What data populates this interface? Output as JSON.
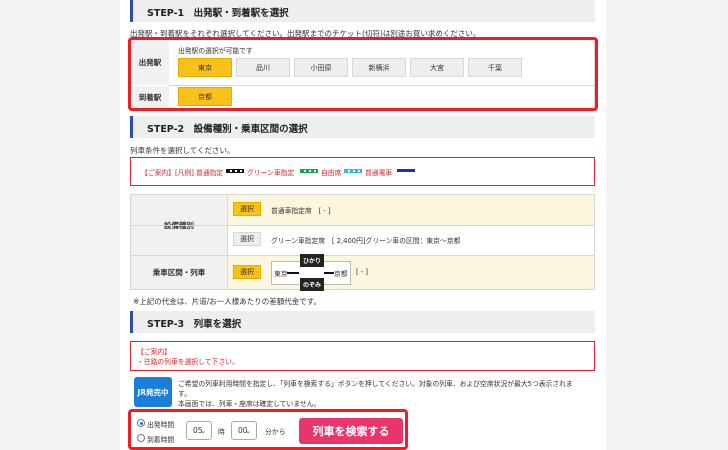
{
  "step1": {
    "title": "STEP-1　出発駅・到着駅を選択",
    "instruction": "出発駅・到着駅をそれぞれ選択してください。出発駅までのチケット(切符)は別途お買い求めください。",
    "depart_label": "出発駅",
    "depart_note": "出発駅の選択が可能です",
    "depart_stations": [
      {
        "label": "東京",
        "selected": true
      },
      {
        "label": "品川",
        "selected": false
      },
      {
        "label": "小田原",
        "selected": false
      },
      {
        "label": "新横浜",
        "selected": false
      },
      {
        "label": "大宮",
        "selected": false
      },
      {
        "label": "千葉",
        "selected": false
      }
    ],
    "arrive_label": "到着駅",
    "arrive_stations": [
      {
        "label": "京都",
        "selected": true
      }
    ]
  },
  "step2": {
    "title": "STEP-2　設備種別・乗車区間の選択",
    "instruction": "列車条件を選択してください。",
    "notice": {
      "prefix": "【ご案内】[凡例] 普通指定",
      "green": "グリーン車指定",
      "free": "自由席",
      "normal": "普通電車"
    },
    "facility_label": "設備種別",
    "facility_options": [
      {
        "button": "選択",
        "text": "普通車指定席　[ - ]",
        "selected": true
      },
      {
        "button": "選択",
        "text": "グリーン車指定席　[ 2,400円]グリーン車の区間：東京〜京都",
        "selected": false
      }
    ],
    "route_label": "乗車区間・列車",
    "route_button": "選択",
    "route_from": "東京",
    "route_to": "京都",
    "train_names": [
      "ひかり",
      "のぞみ"
    ],
    "route_price": "[ - ]",
    "footnote": "※上記の代金は、片道/お一人様あたりの差額代金です。"
  },
  "step3": {
    "title": "STEP-3　列車を選択",
    "notice_title": "【ご案内】",
    "notice_body": "・往路の列車を選択して下さい。",
    "jr_badge": "JR発売中",
    "desc_line1": "ご希望の列車利用時間を指定し、「列車を検索する」ボタンを押してください。対象の列車、および空席状況が最大5つ表示されま",
    "desc_line2": "す。",
    "desc_line3": "本画面では、列車・座席は確定していません。",
    "radio_depart": "出発時間",
    "radio_arrive": "到着時間",
    "hour_value": "05",
    "hour_unit": "時",
    "minute_value": "00",
    "minute_unit": "分から",
    "search_button": "列車を検索する"
  },
  "colors": {
    "accent_yellow": "#f9c21b",
    "highlight_red": "#ee1c25",
    "search_pink": "#e8356b",
    "step_blue": "#2c4fa5",
    "jr_blue": "#1a7fd8"
  }
}
